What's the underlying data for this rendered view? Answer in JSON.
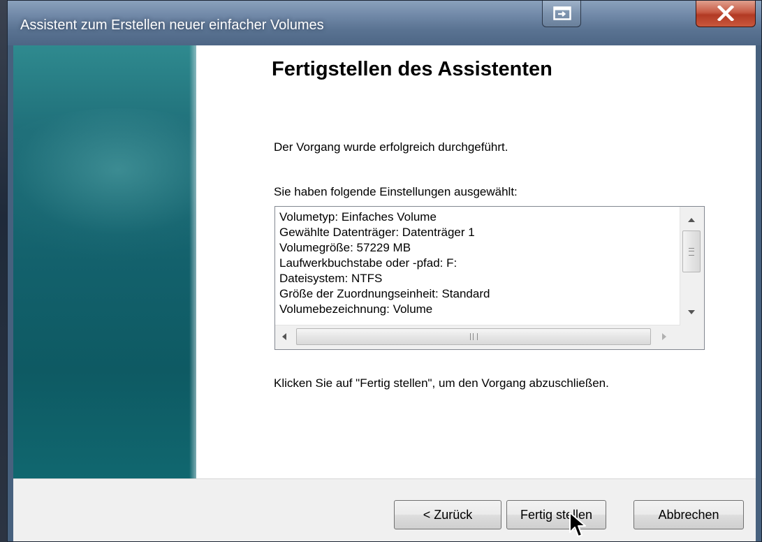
{
  "window": {
    "title": "Assistent zum Erstellen neuer einfacher Volumes",
    "controls": {
      "restore_icon": "restore-window-icon",
      "close_icon": "close-icon",
      "close_color": "#c0452f"
    }
  },
  "page": {
    "heading": "Fertigstellen des Assistenten",
    "success_message": "Der Vorgang wurde erfolgreich durchgeführt.",
    "settings_label": "Sie haben folgende Einstellungen ausgewählt:",
    "settings": [
      "Volumetyp: Einfaches Volume",
      "Gewählte Datenträger: Datenträger 1",
      "Volumegröße: 57229 MB",
      "Laufwerkbuchstabe oder -pfad: F:",
      "Dateisystem: NTFS",
      "Größe der Zuordnungseinheit: Standard",
      "Volumebezeichnung: Volume"
    ],
    "finish_hint": "Klicken Sie auf \"Fertig stellen\", um den Vorgang abzuschließen."
  },
  "buttons": {
    "back": "< Zurück",
    "finish": "Fertig stellen",
    "cancel": "Abbrechen"
  },
  "colors": {
    "banner": "#13616c",
    "titlebar": "#5a7392"
  }
}
